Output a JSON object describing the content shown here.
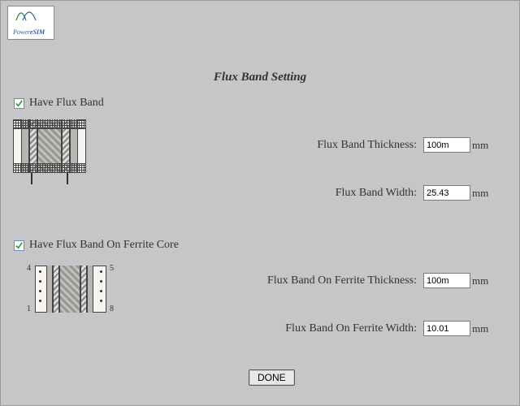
{
  "logo": {
    "brand": "Power",
    "sub": "eSIM"
  },
  "title": "Flux Band Setting",
  "section1": {
    "checkbox_label": "Have Flux Band",
    "checked": true,
    "fields": {
      "thickness": {
        "label": "Flux Band Thickness:",
        "value": "100m",
        "unit": "mm"
      },
      "width": {
        "label": "Flux Band Width:",
        "value": "25.43",
        "unit": "mm"
      }
    }
  },
  "section2": {
    "checkbox_label": "Have Flux Band On Ferrite Core",
    "checked": true,
    "pins": {
      "tl": "4",
      "tr": "5",
      "bl": "1",
      "br": "8"
    },
    "fields": {
      "thickness": {
        "label": "Flux Band On Ferrite Thickness:",
        "value": "100m",
        "unit": "mm"
      },
      "width": {
        "label": "Flux Band On Ferrite Width:",
        "value": "10.01",
        "unit": "mm"
      }
    }
  },
  "done_label": "DONE"
}
